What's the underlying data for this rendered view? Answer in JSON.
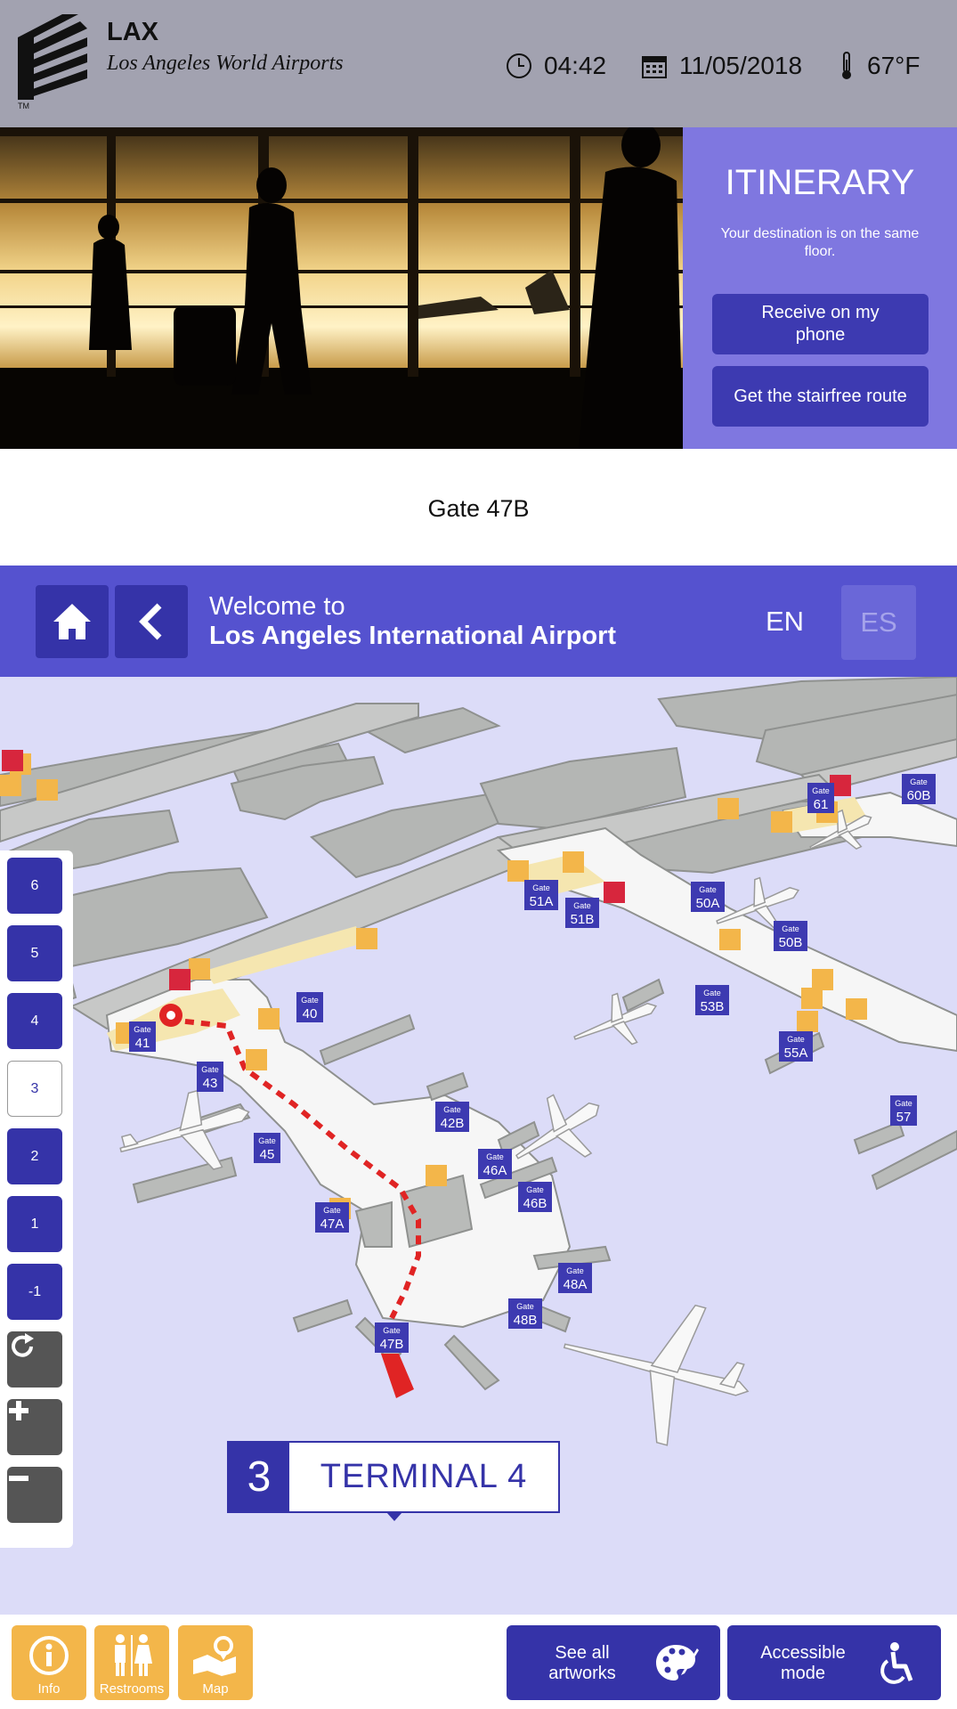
{
  "header": {
    "logo_icon": "lax-logo-icon",
    "code": "LAX",
    "name": "Los Angeles World Airports",
    "time": "04:42",
    "date": "11/05/2018",
    "temperature": "67°F",
    "icons": [
      "clock-icon",
      "calendar-icon",
      "thermometer-icon"
    ]
  },
  "itinerary": {
    "title": "ITINERARY",
    "subtitle": "Your destination is on the same floor.",
    "receive_label": "Receive on my phone",
    "stairfree_label": "Get the stairfree route"
  },
  "destination": {
    "label": "Gate 47B"
  },
  "welcome": {
    "line1": "Welcome to",
    "line2": "Los Angeles International Airport",
    "lang_en": "EN",
    "lang_es": "ES"
  },
  "floors": [
    "6",
    "5",
    "4",
    "3",
    "2",
    "1",
    "-1"
  ],
  "current_floor": "3",
  "map": {
    "terminal_number": "3",
    "terminal_name": "TERMINAL 4",
    "gate_word": "Gate",
    "gates": [
      "41",
      "40",
      "43",
      "45",
      "42B",
      "46A",
      "46B",
      "47A",
      "48A",
      "48B",
      "47B",
      "51A",
      "51B",
      "50A",
      "50B",
      "53B",
      "55A",
      "57",
      "61",
      "60B"
    ],
    "colors": {
      "floor": "#dcdcf8",
      "building": "#b7b9b7",
      "gate": "#3d3ab1",
      "route": "#e02424",
      "service": "#f3b64a",
      "security": "#d7263d"
    }
  },
  "bottom": {
    "info_label": "Info",
    "restrooms_label": "Restrooms",
    "map_label": "Map",
    "artworks_label": "See all artworks",
    "accessible_label": "Accessible mode"
  }
}
